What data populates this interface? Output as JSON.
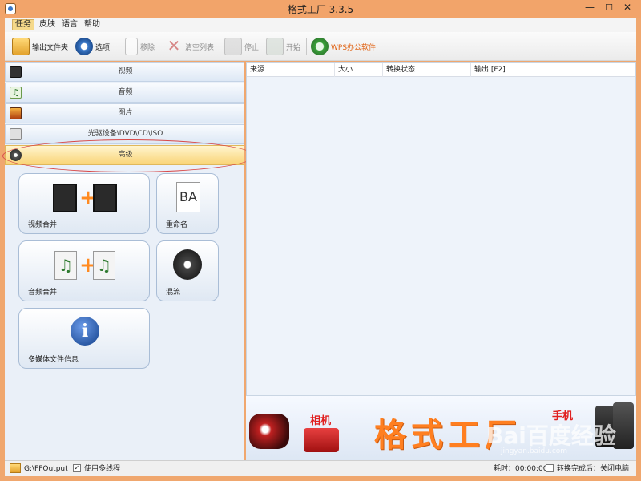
{
  "window": {
    "title": "格式工厂 3.3.5"
  },
  "menu": {
    "items": [
      "任务",
      "皮肤",
      "语言",
      "帮助"
    ]
  },
  "toolbar": {
    "output_folder": "输出文件夹",
    "options": "选项",
    "remove": "移除",
    "clear_list": "清空列表",
    "stop": "停止",
    "start": "开始",
    "wps": "WPS办公软件"
  },
  "categories": [
    "视频",
    "音频",
    "图片",
    "光驱设备\\DVD\\CD\\ISO",
    "高级"
  ],
  "tiles": {
    "video_merge": "视频合并",
    "rename": "重命名",
    "audio_merge": "音频合并",
    "mux": "混流",
    "media_info": "多媒体文件信息"
  },
  "list": {
    "columns": [
      "来源",
      "大小",
      "转换状态",
      "输出 [F2]"
    ]
  },
  "banner": {
    "title": "格式工厂",
    "camera_label": "相机",
    "phone_label": "手机",
    "watermark": "Bai百度经验",
    "watermark_url": "jingyan.baidu.com"
  },
  "status": {
    "output_path": "G:\\FFOutput",
    "multithread": "使用多线程",
    "elapsed": "耗时：00:00:00",
    "after_done": "转换完成后：关闭电脑"
  },
  "colors": {
    "accent": "#ff7f20",
    "title_bar": "#f2a46a",
    "selected_category": "#f9d476"
  }
}
